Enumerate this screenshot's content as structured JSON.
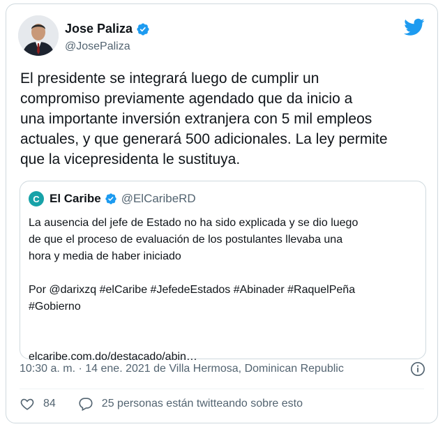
{
  "author": {
    "name": "Jose Paliza",
    "handle": "@JosePaliza"
  },
  "icons": {
    "brand": "twitter-bird-icon",
    "verified": "verified-badge-icon",
    "info": "info-icon",
    "like": "heart-icon",
    "reply": "comment-bubble-icon"
  },
  "colors": {
    "brand_blue": "#1d9bf0",
    "text": "#0f1419",
    "secondary": "#536471",
    "border": "#cfd9de",
    "quote_avatar": "#17a2a8"
  },
  "tweet": {
    "text": "El presidente se integrará luego de cumplir un\ncompromiso previamente agendado que da inicio a\nuna importante inversión extranjera con 5 mil empleos\nactuales, y que generará 500 adicionales. La ley permite\nque la vicepresidenta le sustituya."
  },
  "quoted": {
    "avatar_letter": "C",
    "name": "El Caribe",
    "handle": "@ElCaribeRD",
    "text": "La ausencia del jefe de Estado no ha sido explicada y se dio luego\nde que el proceso de evaluación de los postulantes llevaba una\nhora y media de haber iniciado\n\nPor @darixzq #elCaribe #JefedeEstados #Abinader #RaquelPeña\n#Gobierno",
    "link": "elcaribe.com.do/destacado/abin…"
  },
  "meta": {
    "timestamp": "10:30 a. m. · 14 ene. 2021 de Villa Hermosa, Dominican Republic"
  },
  "actions": {
    "likes": "84",
    "talking": "25 personas están twitteando sobre esto"
  }
}
